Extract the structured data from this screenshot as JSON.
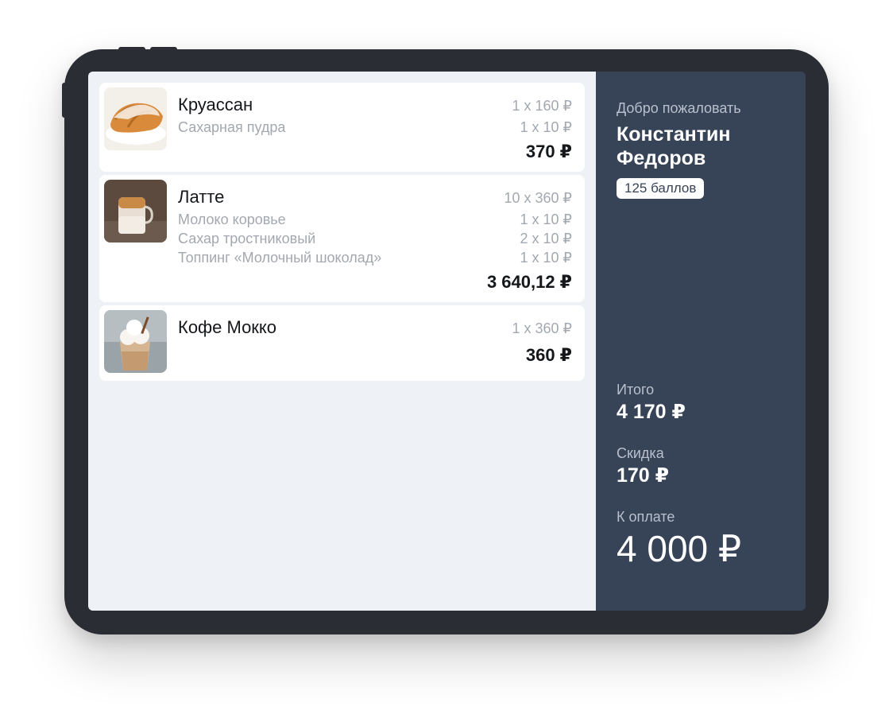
{
  "items": [
    {
      "name": "Круассан",
      "qty": "1 x 160 ₽",
      "modifiers": [
        {
          "name": "Сахарная пудра",
          "qty": "1 x 10 ₽"
        }
      ],
      "total": "370 ₽",
      "image": "croissant-photo"
    },
    {
      "name": "Латте",
      "qty": "10 x 360 ₽",
      "modifiers": [
        {
          "name": "Молоко коровье",
          "qty": "1 x 10 ₽"
        },
        {
          "name": "Сахар тростниковый",
          "qty": "2 x 10 ₽"
        },
        {
          "name": "Топпинг «Молочный шоколад»",
          "qty": "1 x 10 ₽"
        }
      ],
      "total": "3 640,12 ₽",
      "image": "latte-photo"
    },
    {
      "name": "Кофе Мокко",
      "qty": "1 x 360 ₽",
      "modifiers": [],
      "total": "360 ₽",
      "image": "mocha-photo"
    }
  ],
  "customer": {
    "welcome": "Добро пожаловать",
    "name_line1": "Константин",
    "name_line2": "Федоров",
    "points": "125 баллов"
  },
  "summary": {
    "subtotal_label": "Итого",
    "subtotal": "4 170 ₽",
    "discount_label": "Скидка",
    "discount": "170 ₽",
    "pay_label": "К оплате",
    "pay": "4 000 ₽"
  },
  "colors": {
    "device": "#2a2d33",
    "order_bg": "#eef2f7",
    "side_bg": "#374357"
  }
}
